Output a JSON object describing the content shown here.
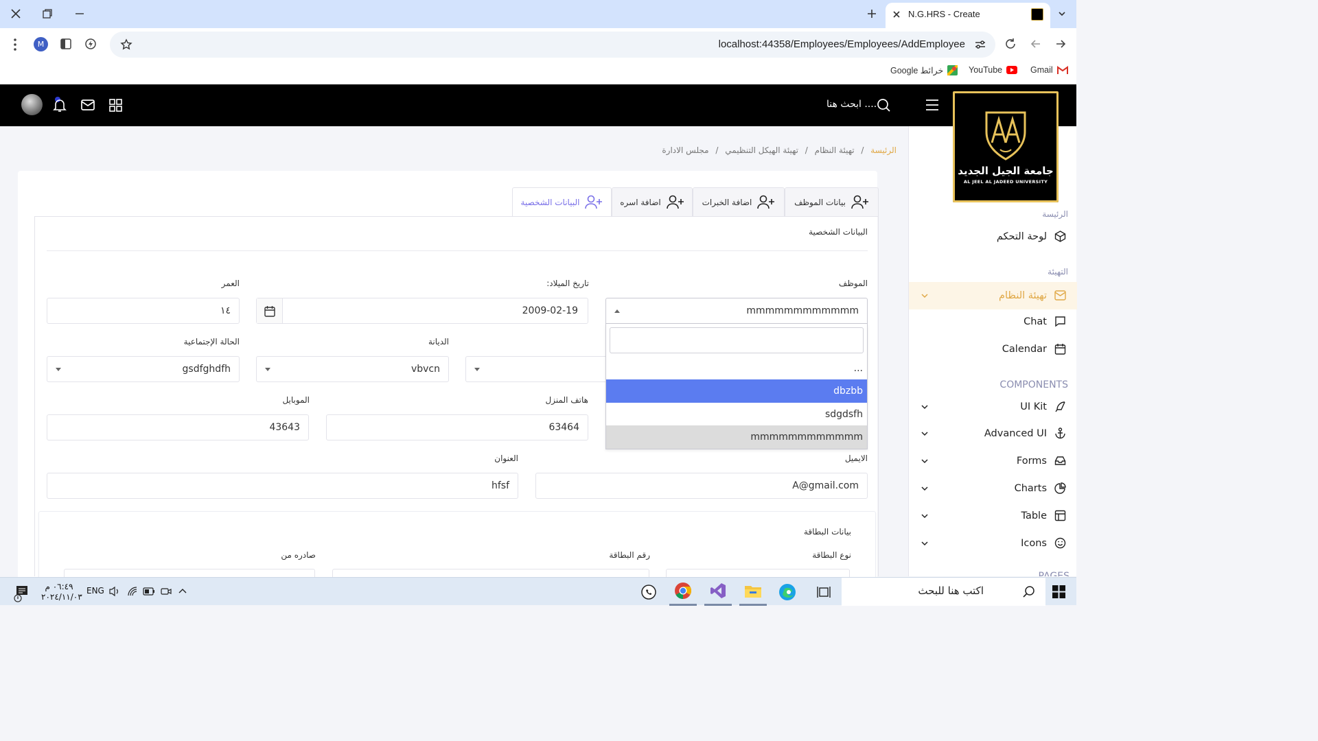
{
  "browser": {
    "tab_title": "N.G.HRS - Create",
    "url": "localhost:44358/Employees/Employees/AddEmployee",
    "profile_initial": "M",
    "bookmarks": [
      {
        "label": "Gmail",
        "icon": "gmail-icon"
      },
      {
        "label": "YouTube",
        "icon": "youtube-icon"
      },
      {
        "label": "Google خرائط",
        "icon": "google-maps-icon"
      }
    ]
  },
  "header": {
    "search_placeholder": "ابحث هنا ....",
    "notification_count": ""
  },
  "logo": {
    "name_ar": "جامعة الجيل الجديد",
    "name_en": "AL JEEL AL JADEED UNIVERSITY"
  },
  "sidebar": {
    "section_home": "الرئيسة",
    "dashboard": "لوحة التحكم",
    "section_setup": "التهيئة",
    "system_setup": "تهيئة النظام",
    "chat": "Chat",
    "calendar": "Calendar",
    "section_components": "COMPONENTS",
    "components": [
      "UI Kit",
      "Advanced UI",
      "Forms",
      "Charts",
      "Table",
      "Icons"
    ],
    "section_pages": "PAGES"
  },
  "breadcrumb": [
    "الرئيسة",
    "تهيئة النظام",
    "تهيئة الهيكل التنظيمي",
    "مجلس الادارة"
  ],
  "tabs": [
    "بيانات الموظف",
    "اضافة الخبرات",
    "اضافة اسره",
    "البيانات الشخصية"
  ],
  "form": {
    "section_title": "البيانات الشخصية",
    "employee_label": "الموظف",
    "employee_value": "mmmmmmmmmmmm",
    "birthdate_label": "تاريخ الميلاد:",
    "birthdate_value": "2009-02-19",
    "age_label": "العمر",
    "age_value": "١٤",
    "religion_label": "الديانة",
    "religion_value": "vbvcn",
    "marital_label": "الحالة الإجتماعية",
    "marital_value": "gsdfghdfh",
    "home_phone_label": "هاتف المنزل",
    "home_phone_value": "63464",
    "mobile_label": "الموبايل",
    "mobile_value": "43643",
    "email_label": "الايميل",
    "email_value": "A@gmail.com",
    "address_label": "العنوان",
    "address_value": "hfsf",
    "card_section_title": "بيانات البطاقة",
    "card_type_label": "نوع البطاقة",
    "card_number_label": "رقم البطاقة",
    "issued_from_label": "صادره من"
  },
  "dropdown": {
    "search_value": "",
    "options": [
      "...",
      "dbzbb",
      "sdgdsfh",
      "mmmmmmmmmmmm"
    ],
    "highlighted": "dbzbb",
    "selected": "mmmmmmmmmmmm"
  },
  "taskbar": {
    "search_placeholder": "اكتب هنا للبحث",
    "language": "ENG",
    "time": "٠٦:٤٩ م",
    "date": "٢٠٢٤/١١/٠٣"
  }
}
